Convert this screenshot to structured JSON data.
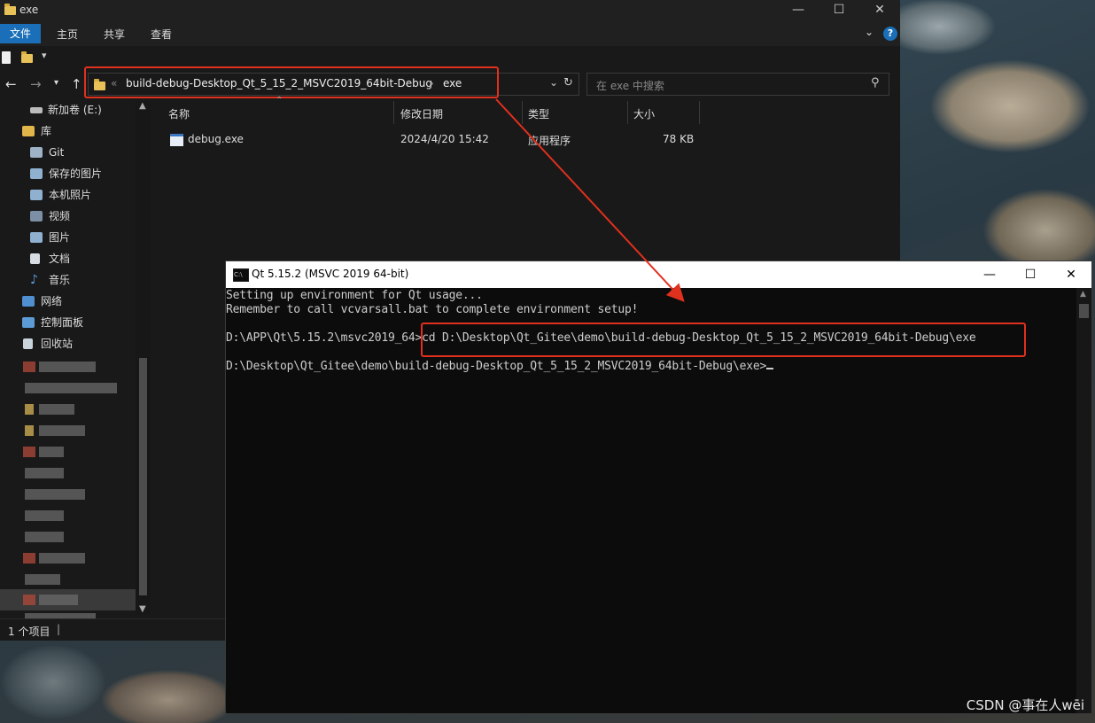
{
  "explorer": {
    "title": "exe",
    "ribbon_tabs": [
      "文件",
      "主页",
      "共享",
      "查看"
    ],
    "address": {
      "overflow": "«",
      "crumbs": [
        "build-debug-Desktop_Qt_5_15_2_MSVC2019_64bit-Debug",
        "exe"
      ],
      "separator": "›"
    },
    "search_placeholder": "在 exe 中搜索",
    "sidebar_items": [
      {
        "label": "新加卷 (E:)",
        "icon": "drive-icon"
      },
      {
        "label": "库",
        "icon": "library-icon"
      },
      {
        "label": "Git",
        "icon": "git-icon"
      },
      {
        "label": "保存的图片",
        "icon": "pictures-icon"
      },
      {
        "label": "本机照片",
        "icon": "pictures-icon"
      },
      {
        "label": "视频",
        "icon": "video-icon"
      },
      {
        "label": "图片",
        "icon": "pictures-icon"
      },
      {
        "label": "文档",
        "icon": "document-icon"
      },
      {
        "label": "音乐",
        "icon": "music-icon"
      },
      {
        "label": "网络",
        "icon": "network-icon"
      },
      {
        "label": "控制面板",
        "icon": "control-panel-icon"
      },
      {
        "label": "回收站",
        "icon": "recycle-bin-icon"
      }
    ],
    "columns": {
      "name": "名称",
      "modified": "修改日期",
      "type": "类型",
      "size": "大小"
    },
    "files": [
      {
        "name": "debug.exe",
        "modified": "2024/4/20 15:42",
        "type": "应用程序",
        "size": "78 KB"
      }
    ],
    "status": "1 个项目",
    "colors": {
      "accent": "#1a6fb8",
      "highlight": "#e0301e"
    }
  },
  "console": {
    "title": "Qt 5.15.2 (MSVC 2019 64-bit)",
    "lines": [
      "Setting up environment for Qt usage...",
      "Remember to call vcvarsall.bat to complete environment setup!",
      "",
      "D:\\APP\\Qt\\5.15.2\\msvc2019_64>cd D:\\Desktop\\Qt_Gitee\\demo\\build-debug-Desktop_Qt_5_15_2_MSVC2019_64bit-Debug\\exe",
      "",
      "D:\\Desktop\\Qt_Gitee\\demo\\build-debug-Desktop_Qt_5_15_2_MSVC2019_64bit-Debug\\exe>"
    ]
  },
  "watermark": "CSDN @事在人wēi"
}
